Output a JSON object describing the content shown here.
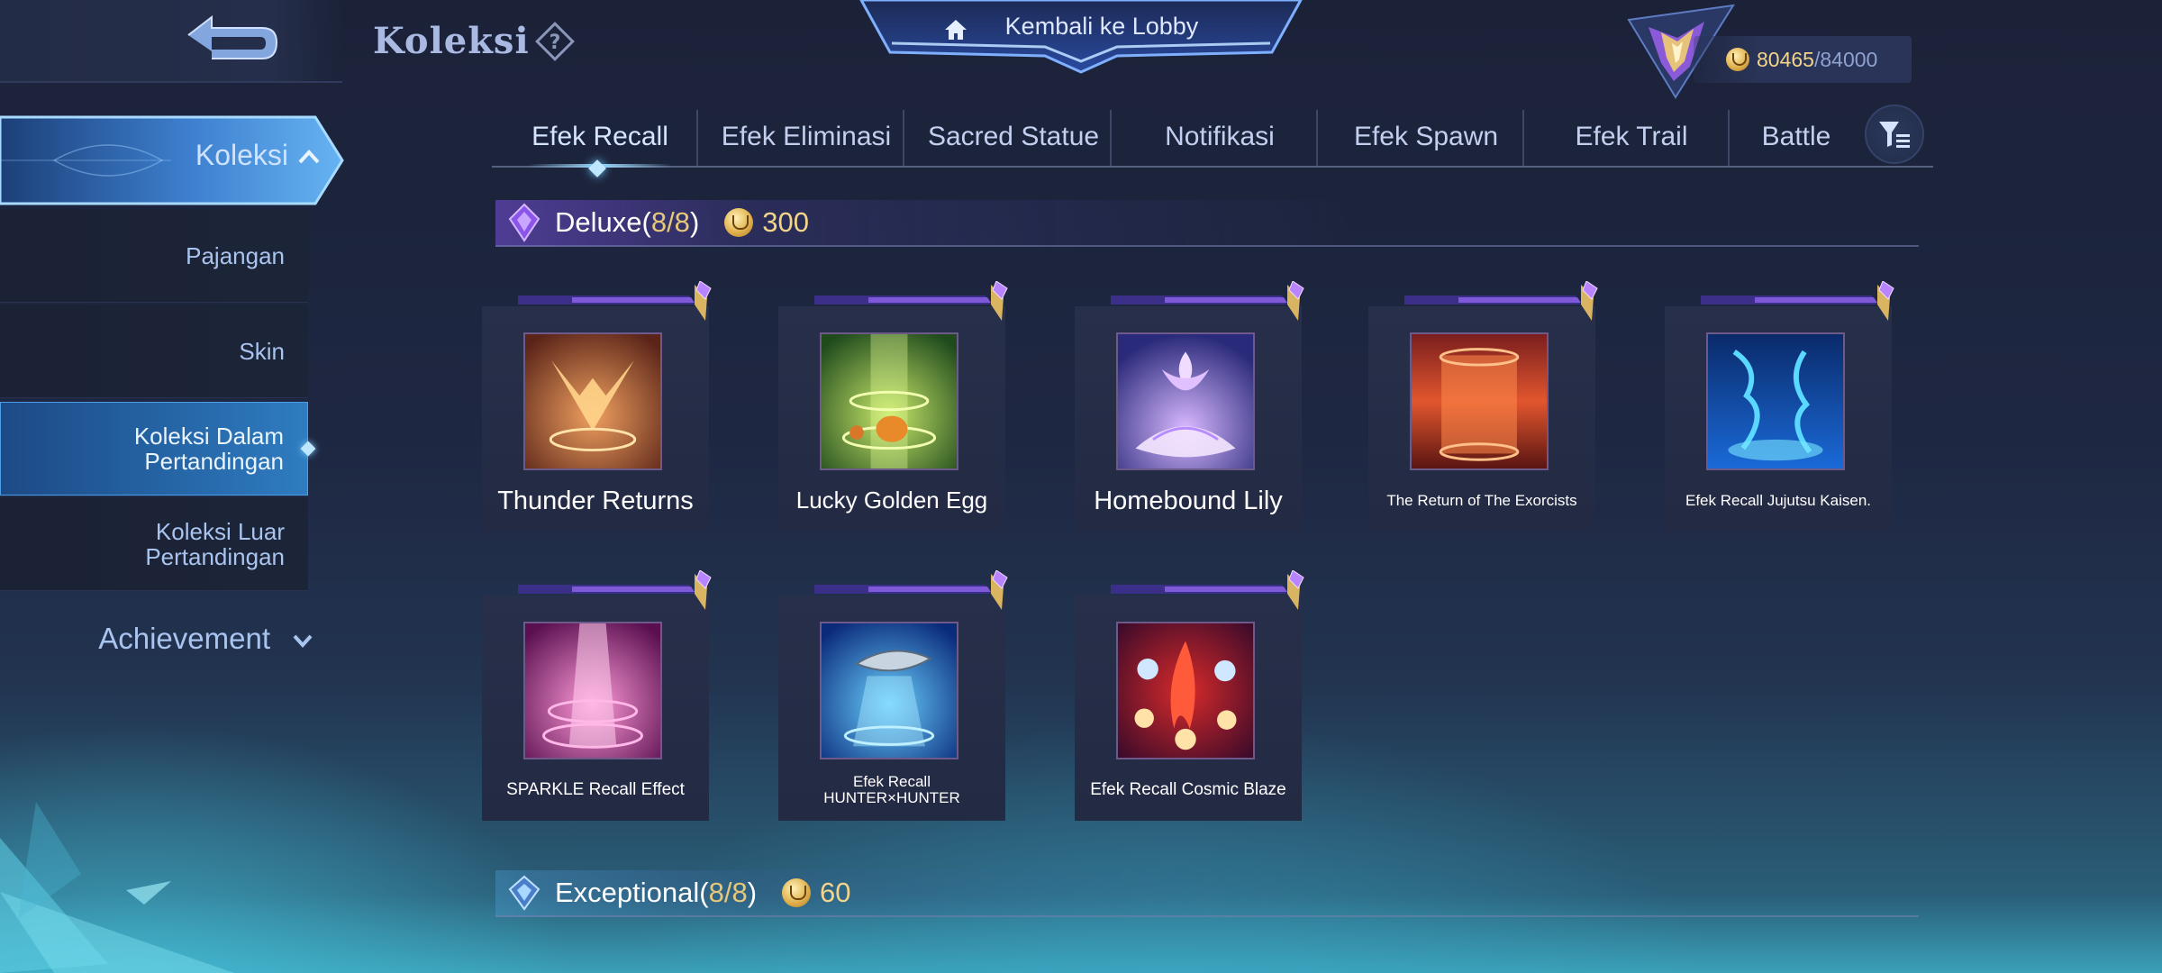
{
  "header": {
    "title": "Koleksi",
    "lobby_button": "Kembali ke Lobby",
    "currency": {
      "current": "80465",
      "max": "/84000"
    }
  },
  "sidebar": {
    "section": "Koleksi",
    "items": [
      {
        "label": "Pajangan"
      },
      {
        "label": "Skin"
      },
      {
        "line1": "Koleksi Dalam",
        "line2": "Pertandingan",
        "active": true
      },
      {
        "line1": "Koleksi Luar",
        "line2": "Pertandingan"
      }
    ],
    "achievement": "Achievement"
  },
  "tabs": [
    {
      "label": "Efek Recall",
      "active": true
    },
    {
      "label": "Efek Eliminasi"
    },
    {
      "label": "Sacred Statue"
    },
    {
      "label": "Notifikasi"
    },
    {
      "label": "Efek Spawn"
    },
    {
      "label": "Efek Trail"
    },
    {
      "label": "Battle"
    }
  ],
  "sections": [
    {
      "name": "Deluxe",
      "count": "8/8",
      "price": "300"
    },
    {
      "name": "Exceptional",
      "count": "8/8",
      "price": "60"
    }
  ],
  "cards": [
    {
      "name": "Thunder Returns"
    },
    {
      "name": "Lucky Golden Egg"
    },
    {
      "name": "Homebound Lily"
    },
    {
      "name": "The Return of The Exorcists"
    },
    {
      "name": "Efek Recall Jujutsu Kaisen."
    },
    {
      "name": "SPARKLE Recall Effect"
    },
    {
      "line1": "Efek Recall",
      "line2": "HUNTER×HUNTER"
    },
    {
      "name": "Efek Recall Cosmic Blaze"
    }
  ],
  "colors": {
    "accent_blue": "#2f7cc0",
    "gold": "#f2d48a",
    "deluxe_purple": "#7b4fe0",
    "text_muted": "#a9c4ef"
  },
  "icons": {
    "back": "back-arrow-icon",
    "help": "question-diamond-icon",
    "home": "home-icon",
    "filter": "filter-icon",
    "currency": "coin-icon"
  }
}
